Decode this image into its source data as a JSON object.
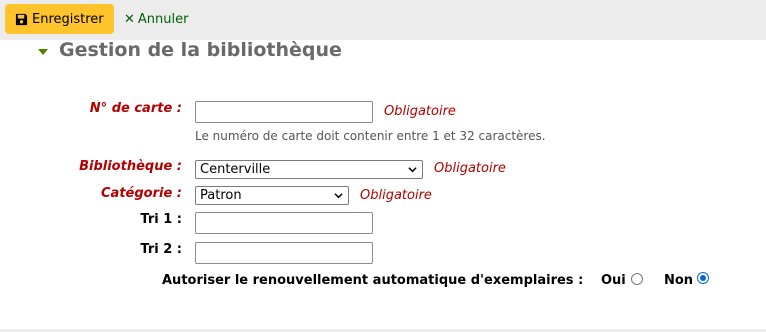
{
  "toolbar": {
    "save_label": "Enregistrer",
    "cancel_label": "Annuler",
    "cancel_icon": "✕"
  },
  "section": {
    "title": "Gestion de la bibliothèque"
  },
  "form": {
    "card_number": {
      "label": "N° de carte :",
      "value": "",
      "required": "Obligatoire",
      "hint": "Le numéro de carte doit contenir entre 1 et 32 caractères."
    },
    "library": {
      "label": "Bibliothèque :",
      "selected": "Centerville",
      "required": "Obligatoire"
    },
    "category": {
      "label": "Catégorie :",
      "selected": "Patron",
      "required": "Obligatoire"
    },
    "sort1": {
      "label": "Tri 1 :",
      "value": ""
    },
    "sort2": {
      "label": "Tri 2 :",
      "value": ""
    },
    "auto_renew": {
      "label": "Autoriser le renouvellement automatique d'exemplaires :",
      "yes_label": "Oui",
      "no_label": "Non",
      "selected": "Non"
    }
  },
  "colors": {
    "save_button": "#ffc32b",
    "cancel_link": "#006100",
    "required": "#b30000",
    "section_title": "#696969",
    "caret": "#538200"
  }
}
